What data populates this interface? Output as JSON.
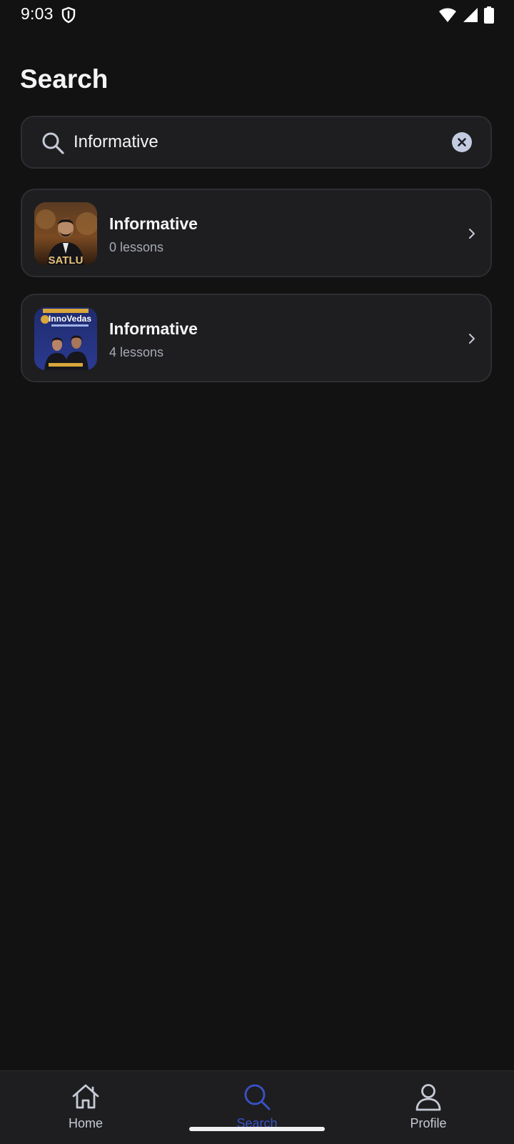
{
  "status_bar": {
    "time": "9:03",
    "icons": [
      "shield-icon",
      "wifi-icon",
      "cell-signal-icon",
      "battery-icon"
    ]
  },
  "page": {
    "title": "Search"
  },
  "search": {
    "value": "Informative",
    "icon": "search-icon",
    "clear_icon": "close-icon"
  },
  "results": [
    {
      "title": "Informative",
      "subtitle": "0 lessons",
      "thumbnail_text": "SATLU",
      "icon": "chevron-right-icon"
    },
    {
      "title": "Informative",
      "subtitle": "4 lessons",
      "thumbnail_text": "InnoVedas",
      "icon": "chevron-right-icon"
    }
  ],
  "bottom_nav": {
    "items": [
      {
        "label": "Home",
        "icon": "home-icon",
        "active": false
      },
      {
        "label": "Search",
        "icon": "search-icon",
        "active": true
      },
      {
        "label": "Profile",
        "icon": "profile-icon",
        "active": false
      }
    ]
  },
  "colors": {
    "background": "#121212",
    "surface": "#1e1e20",
    "border": "#2e2e32",
    "accent": "#3a52c8",
    "text_primary": "#f4f4f6",
    "text_secondary": "#a6a9b6"
  }
}
